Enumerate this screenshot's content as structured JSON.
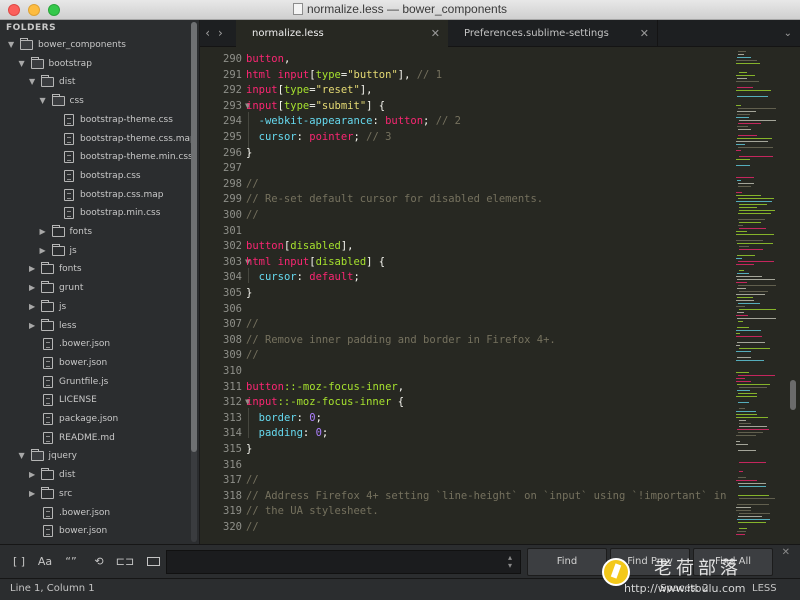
{
  "window": {
    "title": "normalize.less — bower_components"
  },
  "sidebar": {
    "header": "FOLDERS",
    "items": [
      {
        "label": "bower_components",
        "depth": 0,
        "type": "folder",
        "expanded": true
      },
      {
        "label": "bootstrap",
        "depth": 1,
        "type": "folder",
        "expanded": true
      },
      {
        "label": "dist",
        "depth": 2,
        "type": "folder",
        "expanded": true
      },
      {
        "label": "css",
        "depth": 3,
        "type": "folder",
        "expanded": true
      },
      {
        "label": "bootstrap-theme.css",
        "depth": 4,
        "type": "file"
      },
      {
        "label": "bootstrap-theme.css.map",
        "depth": 4,
        "type": "file"
      },
      {
        "label": "bootstrap-theme.min.css",
        "depth": 4,
        "type": "file"
      },
      {
        "label": "bootstrap.css",
        "depth": 4,
        "type": "file"
      },
      {
        "label": "bootstrap.css.map",
        "depth": 4,
        "type": "file"
      },
      {
        "label": "bootstrap.min.css",
        "depth": 4,
        "type": "file"
      },
      {
        "label": "fonts",
        "depth": 3,
        "type": "folder",
        "expanded": false
      },
      {
        "label": "js",
        "depth": 3,
        "type": "folder",
        "expanded": false
      },
      {
        "label": "fonts",
        "depth": 2,
        "type": "folder",
        "expanded": false
      },
      {
        "label": "grunt",
        "depth": 2,
        "type": "folder",
        "expanded": false
      },
      {
        "label": "js",
        "depth": 2,
        "type": "folder",
        "expanded": false
      },
      {
        "label": "less",
        "depth": 2,
        "type": "folder",
        "expanded": false
      },
      {
        "label": ".bower.json",
        "depth": 2,
        "type": "file"
      },
      {
        "label": "bower.json",
        "depth": 2,
        "type": "file"
      },
      {
        "label": "Gruntfile.js",
        "depth": 2,
        "type": "file"
      },
      {
        "label": "LICENSE",
        "depth": 2,
        "type": "file"
      },
      {
        "label": "package.json",
        "depth": 2,
        "type": "file"
      },
      {
        "label": "README.md",
        "depth": 2,
        "type": "file"
      },
      {
        "label": "jquery",
        "depth": 1,
        "type": "folder",
        "expanded": true
      },
      {
        "label": "dist",
        "depth": 2,
        "type": "folder",
        "expanded": false
      },
      {
        "label": "src",
        "depth": 2,
        "type": "folder",
        "expanded": false
      },
      {
        "label": ".bower.json",
        "depth": 2,
        "type": "file"
      },
      {
        "label": "bower.json",
        "depth": 2,
        "type": "file"
      }
    ]
  },
  "tabs": [
    {
      "label": "normalize.less",
      "active": true
    },
    {
      "label": "Preferences.sublime-settings",
      "active": false
    }
  ],
  "editor": {
    "lines": [
      {
        "n": "290",
        "fold": false,
        "tokens": [
          [
            "t-tag",
            "button"
          ],
          [
            "t-txt",
            ","
          ]
        ]
      },
      {
        "n": "291",
        "fold": false,
        "tokens": [
          [
            "t-tag",
            "html"
          ],
          [
            "t-txt",
            " "
          ],
          [
            "t-tag",
            "input"
          ],
          [
            "t-txt",
            "["
          ],
          [
            "t-attr",
            "type"
          ],
          [
            "t-txt",
            "="
          ],
          [
            "t-str",
            "\"button\""
          ],
          [
            "t-txt",
            "], "
          ],
          [
            "t-com",
            "// 1"
          ]
        ]
      },
      {
        "n": "292",
        "fold": false,
        "tokens": [
          [
            "t-tag",
            "input"
          ],
          [
            "t-txt",
            "["
          ],
          [
            "t-attr",
            "type"
          ],
          [
            "t-txt",
            "="
          ],
          [
            "t-str",
            "\"reset\""
          ],
          [
            "t-txt",
            "],"
          ]
        ]
      },
      {
        "n": "293",
        "fold": true,
        "tokens": [
          [
            "t-tag",
            "input"
          ],
          [
            "t-txt",
            "["
          ],
          [
            "t-attr",
            "type"
          ],
          [
            "t-txt",
            "="
          ],
          [
            "t-str",
            "\"submit\""
          ],
          [
            "t-txt",
            "] {"
          ]
        ]
      },
      {
        "n": "294",
        "fold": false,
        "tokens": [
          [
            "t-txt",
            "  "
          ],
          [
            "t-prop",
            "-webkit-appearance"
          ],
          [
            "t-txt",
            ": "
          ],
          [
            "t-val",
            "button"
          ],
          [
            "t-txt",
            "; "
          ],
          [
            "t-com",
            "// 2"
          ]
        ]
      },
      {
        "n": "295",
        "fold": false,
        "tokens": [
          [
            "t-txt",
            "  "
          ],
          [
            "t-prop",
            "cursor"
          ],
          [
            "t-txt",
            ": "
          ],
          [
            "t-val",
            "pointer"
          ],
          [
            "t-txt",
            "; "
          ],
          [
            "t-com",
            "// 3"
          ]
        ]
      },
      {
        "n": "296",
        "fold": false,
        "tokens": [
          [
            "t-txt",
            "}"
          ]
        ]
      },
      {
        "n": "297",
        "fold": false,
        "tokens": []
      },
      {
        "n": "298",
        "fold": false,
        "tokens": [
          [
            "t-com",
            "//"
          ]
        ]
      },
      {
        "n": "299",
        "fold": false,
        "tokens": [
          [
            "t-com",
            "// Re-set default cursor for disabled elements."
          ]
        ]
      },
      {
        "n": "300",
        "fold": false,
        "tokens": [
          [
            "t-com",
            "//"
          ]
        ]
      },
      {
        "n": "301",
        "fold": false,
        "tokens": []
      },
      {
        "n": "302",
        "fold": false,
        "tokens": [
          [
            "t-tag",
            "button"
          ],
          [
            "t-txt",
            "["
          ],
          [
            "t-attr",
            "disabled"
          ],
          [
            "t-txt",
            "],"
          ]
        ]
      },
      {
        "n": "303",
        "fold": true,
        "tokens": [
          [
            "t-tag",
            "html"
          ],
          [
            "t-txt",
            " "
          ],
          [
            "t-tag",
            "input"
          ],
          [
            "t-txt",
            "["
          ],
          [
            "t-attr",
            "disabled"
          ],
          [
            "t-txt",
            "] {"
          ]
        ]
      },
      {
        "n": "304",
        "fold": false,
        "tokens": [
          [
            "t-txt",
            "  "
          ],
          [
            "t-prop",
            "cursor"
          ],
          [
            "t-txt",
            ": "
          ],
          [
            "t-val",
            "default"
          ],
          [
            "t-txt",
            ";"
          ]
        ]
      },
      {
        "n": "305",
        "fold": false,
        "tokens": [
          [
            "t-txt",
            "}"
          ]
        ]
      },
      {
        "n": "306",
        "fold": false,
        "tokens": []
      },
      {
        "n": "307",
        "fold": false,
        "tokens": [
          [
            "t-com",
            "//"
          ]
        ]
      },
      {
        "n": "308",
        "fold": false,
        "tokens": [
          [
            "t-com",
            "// Remove inner padding and border in Firefox 4+."
          ]
        ]
      },
      {
        "n": "309",
        "fold": false,
        "tokens": [
          [
            "t-com",
            "//"
          ]
        ]
      },
      {
        "n": "310",
        "fold": false,
        "tokens": []
      },
      {
        "n": "311",
        "fold": false,
        "tokens": [
          [
            "t-tag",
            "button"
          ],
          [
            "t-attr",
            "::-moz-focus-inner"
          ],
          [
            "t-txt",
            ","
          ]
        ]
      },
      {
        "n": "312",
        "fold": true,
        "tokens": [
          [
            "t-tag",
            "input"
          ],
          [
            "t-attr",
            "::-moz-focus-inner"
          ],
          [
            "t-txt",
            " {"
          ]
        ]
      },
      {
        "n": "313",
        "fold": false,
        "tokens": [
          [
            "t-txt",
            "  "
          ],
          [
            "t-prop",
            "border"
          ],
          [
            "t-txt",
            ": "
          ],
          [
            "t-num",
            "0"
          ],
          [
            "t-txt",
            ";"
          ]
        ]
      },
      {
        "n": "314",
        "fold": false,
        "tokens": [
          [
            "t-txt",
            "  "
          ],
          [
            "t-prop",
            "padding"
          ],
          [
            "t-txt",
            ": "
          ],
          [
            "t-num",
            "0"
          ],
          [
            "t-txt",
            ";"
          ]
        ]
      },
      {
        "n": "315",
        "fold": false,
        "tokens": [
          [
            "t-txt",
            "}"
          ]
        ]
      },
      {
        "n": "316",
        "fold": false,
        "tokens": []
      },
      {
        "n": "317",
        "fold": false,
        "tokens": [
          [
            "t-com",
            "//"
          ]
        ]
      },
      {
        "n": "318",
        "fold": false,
        "tokens": [
          [
            "t-com",
            "// Address Firefox 4+ setting `line-height` on `input` using `!important` in"
          ]
        ]
      },
      {
        "n": "319",
        "fold": false,
        "tokens": [
          [
            "t-com",
            "// the UA stylesheet."
          ]
        ]
      },
      {
        "n": "320",
        "fold": false,
        "tokens": [
          [
            "t-com",
            "//"
          ]
        ]
      }
    ]
  },
  "find_panel": {
    "regex_label": "[ ]",
    "case_label": "Aa",
    "word_label": "“”",
    "find_label": "Find",
    "find_prev_label": "Find Prev",
    "find_all_label": "Find All",
    "input_value": ""
  },
  "status": {
    "position": "Line 1, Column 1",
    "spaces": "Spaces: 2",
    "syntax": "LESS"
  },
  "watermark": {
    "cn_text": "老荷部落",
    "url": "http://www.itbulu.com"
  },
  "colors": {
    "editor_bg": "#272822",
    "sidebar_bg": "#2b2d2f",
    "keyword": "#f92672",
    "attribute": "#a6e22e",
    "string": "#e6db74",
    "comment": "#75715e",
    "number": "#ae81ff",
    "property": "#66d9ef"
  }
}
